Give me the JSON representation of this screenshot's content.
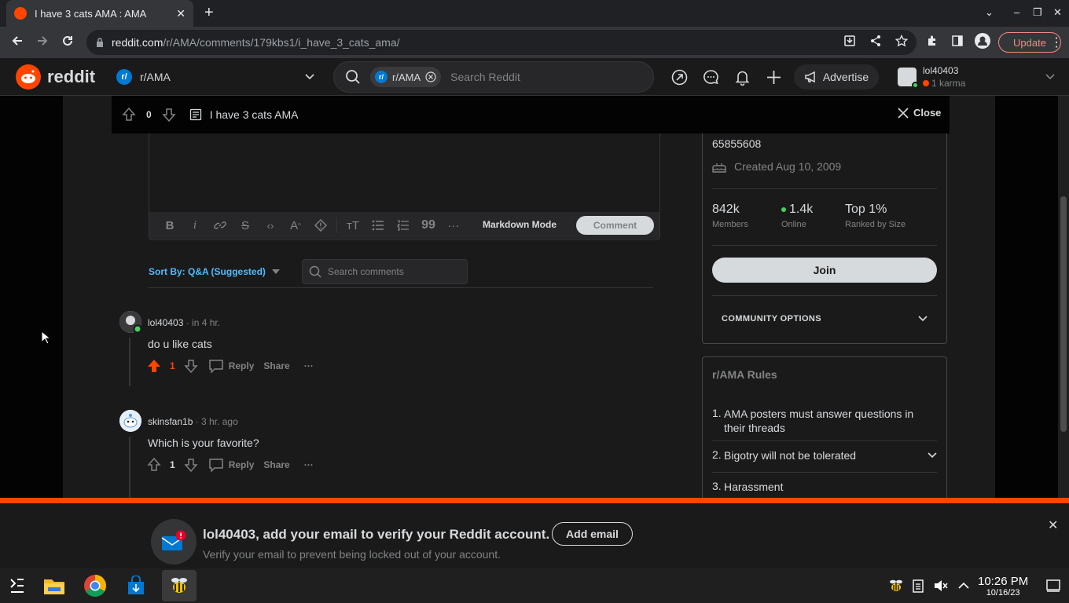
{
  "browser": {
    "tab_title": "I have 3 cats AMA : AMA",
    "url_host": "reddit.com",
    "url_path": "/r/AMA/comments/179kbs1/i_have_3_cats_ama/",
    "update_label": "Update"
  },
  "header": {
    "logo_text": "reddit",
    "community": "r/AMA",
    "search_chip": "r/AMA",
    "search_placeholder": "Search Reddit",
    "advertise_label": "Advertise",
    "username": "lol40403",
    "karma": "1 karma"
  },
  "post": {
    "score": "0",
    "title": "I have 3 cats AMA",
    "close_label": "Close"
  },
  "editor": {
    "markdown_mode": "Markdown Mode",
    "comment_button": "Comment"
  },
  "comments_controls": {
    "sort_label": "Sort By: Q&A (Suggested)",
    "search_placeholder": "Search comments"
  },
  "comments": [
    {
      "author": "lol40403",
      "time": " · in 4 hr.",
      "body": "do u like cats",
      "votes": "1",
      "reply": "Reply",
      "share": "Share",
      "upvoted": true
    },
    {
      "author": "skinsfan1b",
      "time": " · 3 hr. ago",
      "body": "Which is your favorite?",
      "votes": "1",
      "reply": "Reply",
      "share": "Share",
      "upvoted": false
    }
  ],
  "sidebar": {
    "partial_text": "65855608",
    "created": "Created Aug 10, 2009",
    "stats": [
      {
        "value": "842k",
        "label": "Members"
      },
      {
        "value": "1.4k",
        "label": "Online"
      },
      {
        "value": "Top 1%",
        "label": "Ranked by Size"
      }
    ],
    "join_label": "Join",
    "community_options": "COMMUNITY OPTIONS",
    "rules_title": "r/AMA Rules",
    "rules": [
      {
        "num": "1.",
        "text": "AMA posters must answer questions in their threads"
      },
      {
        "num": "2.",
        "text": "Bigotry will not be tolerated"
      },
      {
        "num": "3.",
        "text": "Harassment"
      }
    ]
  },
  "email_banner": {
    "headline": "lol40403, add your email to verify your Reddit account.",
    "sub": "Verify your email to prevent being locked out of your account.",
    "button": "Add email"
  },
  "taskbar": {
    "time": "10:26 PM",
    "date": "10/16/23"
  },
  "colors": {
    "reddit_orange": "#ff4500",
    "link_blue": "#4fbcff",
    "online_green": "#46d160"
  }
}
